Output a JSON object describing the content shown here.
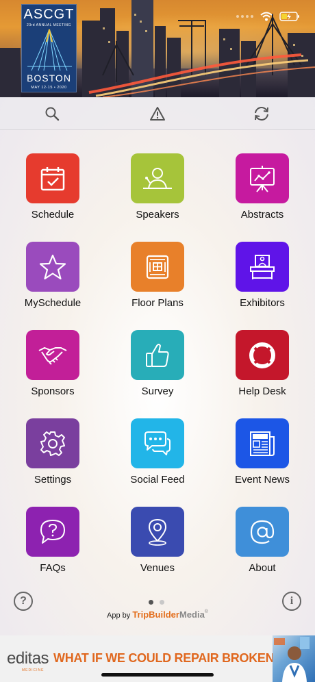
{
  "status_bar": {
    "time": "",
    "icons": [
      "wifi-icon",
      "battery-charging-icon"
    ]
  },
  "logo": {
    "line1": "ASCGT",
    "line2": "23rd ANNUAL MEETING",
    "city": "BOSTON",
    "dates": "MAY 12-15 • 2020"
  },
  "toolbar": {
    "buttons": [
      "search-icon",
      "alert-icon",
      "refresh-icon"
    ]
  },
  "tiles": [
    {
      "label": "Schedule",
      "color": "#e63b2e",
      "icon": "calendar-check-icon"
    },
    {
      "label": "Speakers",
      "color": "#a6c43a",
      "icon": "speaker-podium-icon"
    },
    {
      "label": "Abstracts",
      "color": "#c61a9f",
      "icon": "presentation-chart-icon"
    },
    {
      "label": "MySchedule",
      "color": "#9a4bbd",
      "icon": "star-icon"
    },
    {
      "label": "Floor Plans",
      "color": "#e8802a",
      "icon": "floor-plan-icon"
    },
    {
      "label": "Exhibitors",
      "color": "#5f14e8",
      "icon": "booth-icon"
    },
    {
      "label": "Sponsors",
      "color": "#c21f98",
      "icon": "handshake-icon"
    },
    {
      "label": "Survey",
      "color": "#28adb8",
      "icon": "thumbs-up-icon"
    },
    {
      "label": "Help Desk",
      "color": "#c4172b",
      "icon": "lifebuoy-icon"
    },
    {
      "label": "Settings",
      "color": "#7a3f9e",
      "icon": "gear-icon"
    },
    {
      "label": "Social Feed",
      "color": "#22b5e8",
      "icon": "chat-bubbles-icon"
    },
    {
      "label": "Event News",
      "color": "#1c56e6",
      "icon": "newspaper-icon"
    },
    {
      "label": "FAQs",
      "color": "#8d22b0",
      "icon": "question-bubble-icon"
    },
    {
      "label": "Venues",
      "color": "#3a4bb0",
      "icon": "map-pin-icon"
    },
    {
      "label": "About",
      "color": "#3f8fd9",
      "icon": "at-sign-icon"
    }
  ],
  "footer": {
    "help_symbol": "?",
    "info_symbol": "i",
    "credit_prefix": "App by",
    "credit_brand_1": "TripBuilder",
    "credit_brand_2": "Media",
    "trademark": "®",
    "active_page": 1,
    "page_count": 2
  },
  "ad": {
    "brand": "editas",
    "brand_sub": "MEDICINE",
    "headline": "WHAT IF WE COULD REPAIR BROKEN GENES?"
  },
  "colors": {
    "accent_orange": "#e36f1e",
    "pager_active": "#555555",
    "pager_inactive": "#c8c8c8"
  }
}
